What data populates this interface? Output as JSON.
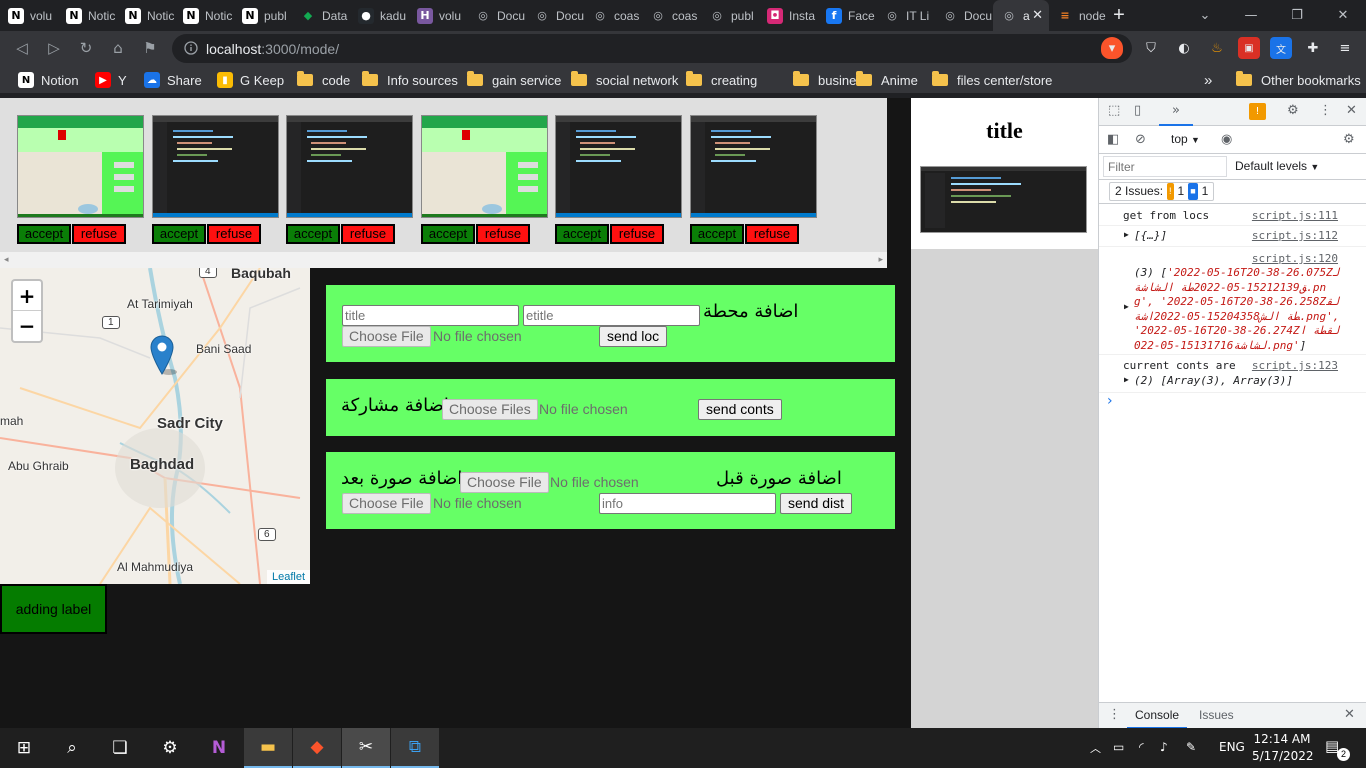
{
  "browser": {
    "tabs": [
      {
        "label": "volu",
        "icon": "notion-icon"
      },
      {
        "label": "Notic",
        "icon": "notion-icon"
      },
      {
        "label": "Notic",
        "icon": "notion-icon"
      },
      {
        "label": "Notic",
        "icon": "notion-icon"
      },
      {
        "label": "publ",
        "icon": "notion-icon"
      },
      {
        "label": "Data",
        "icon": "mongodb-icon"
      },
      {
        "label": "kadu",
        "icon": "github-icon"
      },
      {
        "label": "volu",
        "icon": "heroku-icon"
      },
      {
        "label": "Docu",
        "icon": "globe-icon"
      },
      {
        "label": "Docu",
        "icon": "globe-icon"
      },
      {
        "label": "coas",
        "icon": "globe-icon"
      },
      {
        "label": "coas",
        "icon": "globe-icon"
      },
      {
        "label": "publ",
        "icon": "globe-icon"
      },
      {
        "label": "Insta",
        "icon": "instagram-icon"
      },
      {
        "label": "Face",
        "icon": "facebook-icon"
      },
      {
        "label": "IT Li",
        "icon": "globe-icon"
      },
      {
        "label": "Docu",
        "icon": "globe-icon"
      },
      {
        "label": "a",
        "icon": "globe-icon",
        "active": true
      },
      {
        "label": "node",
        "icon": "stackoverflow-icon"
      }
    ],
    "close_tab": "✕",
    "new_tab": "+",
    "url_host": "localhost",
    "url_path": ":3000/mode/",
    "bookmarks": [
      {
        "label": "Notion",
        "icon": "notion-icon"
      },
      {
        "label": "Y",
        "icon": "youtube-icon"
      },
      {
        "label": "Share",
        "icon": "share-icon"
      },
      {
        "label": "G Keep",
        "icon": "keep-icon"
      },
      {
        "label": "code",
        "icon": "folder-icon"
      },
      {
        "label": "Info sources",
        "icon": "folder-icon"
      },
      {
        "label": "gain service",
        "icon": "folder-icon"
      },
      {
        "label": "social network",
        "icon": "folder-icon"
      },
      {
        "label": "creating",
        "icon": "folder-icon"
      },
      {
        "label": "business",
        "icon": "folder-icon"
      },
      {
        "label": "Anime",
        "icon": "folder-icon"
      },
      {
        "label": "files center/store",
        "icon": "folder-icon"
      }
    ],
    "bookmarks_overflow": "»",
    "other_bookmarks": "Other bookmarks"
  },
  "gallery": {
    "items": [
      {
        "accept": "accept",
        "refuse": "refuse",
        "style": "green"
      },
      {
        "accept": "accept",
        "refuse": "refuse",
        "style": "dark"
      },
      {
        "accept": "accept",
        "refuse": "refuse",
        "style": "dark"
      },
      {
        "accept": "accept",
        "refuse": "refuse",
        "style": "green"
      },
      {
        "accept": "accept",
        "refuse": "refuse",
        "style": "dark"
      },
      {
        "accept": "accept",
        "refuse": "refuse",
        "style": "dark"
      }
    ]
  },
  "map": {
    "zoom_in": "+",
    "zoom_out": "−",
    "attribution": "Leaflet",
    "labels": {
      "baqubah": "Baqubah",
      "tarimiyah": "At Tarimiyah",
      "bani_saad": "Bani Saad",
      "sadr_city": "Sadr City",
      "baghdad": "Baghdad",
      "abu_ghraib": "Abu Ghraib",
      "mah": "mah",
      "mahmudiya": "Al Mahmudiya"
    },
    "road_badges": {
      "r4": "4",
      "r1": "1",
      "r6": "6"
    }
  },
  "forms": {
    "station": {
      "title_placeholder": "title",
      "etitle_placeholder": "etitle",
      "heading": "اضافة محطة",
      "choose_file": "Choose File",
      "no_file": "No file chosen",
      "submit": "send loc"
    },
    "participation": {
      "heading": "اضافة مشاركة",
      "choose_files": "Choose Files",
      "no_file": "No file chosen",
      "submit": "send conts"
    },
    "before_after": {
      "after_heading": "اضافة صورة بعد",
      "before_heading": "اضافة صورة قبل",
      "choose_file": "Choose File",
      "no_file": "No file chosen",
      "info_placeholder": "info",
      "submit": "send dist"
    }
  },
  "adding_label": "adding label",
  "side": {
    "title": "title"
  },
  "devtools": {
    "context": "top",
    "filter_placeholder": "Filter",
    "levels": "Default levels",
    "issues_label": "2 Issues:",
    "issues_warn": "1",
    "issues_info": "1",
    "logs": [
      {
        "text": "get from locs",
        "src": "script.js:111"
      },
      {
        "text": "[{…}]",
        "src": "script.js:112"
      },
      {
        "src": "script.js:120",
        "text_prefix": "(3) [",
        "text_array": "'2022-05-16T20-38-26.075Zلق15212139-05-2022طة الشاشة.png', '2022-05-16T20-38-26.258Zلقطة الش15204358-05-2022اشة.png', '2022-05-16T20-38-26.274Zلقطة الشاشة15131716-05-022.png'",
        "text_suffix": "]"
      },
      {
        "text": "current conts are",
        "src": "script.js:123"
      },
      {
        "text": "(2) [Array(3), Array(3)]"
      }
    ],
    "prompt": "›",
    "drawer_tabs": [
      "Console",
      "Issues"
    ]
  },
  "taskbar": {
    "lang": "ENG",
    "time": "12:14 AM",
    "date": "5/17/2022",
    "notifications": "2"
  }
}
